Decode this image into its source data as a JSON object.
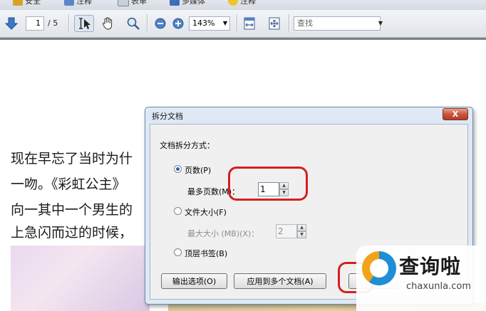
{
  "menu": {
    "items": [
      "安全",
      "注释",
      "表单",
      "多媒体",
      "注释"
    ]
  },
  "toolbar": {
    "page_current": "1",
    "page_total": "/ 5",
    "zoom": "143%",
    "search_placeholder": "查找"
  },
  "document": {
    "lines": [
      "现在早忘了当时为什",
      "一吻。《彩虹公主》",
      "向一其中一个男生的",
      "上急闪而过的时候，"
    ]
  },
  "dialog": {
    "title": "拆分文档",
    "close_label": "X",
    "section_label": "文档拆分方式：",
    "options": {
      "pages_label": "页数(P)",
      "max_pages_label": "最多页数(M)：",
      "max_pages_value": "1",
      "filesize_label": "文件大小(F)",
      "max_size_label": "最大大小 (MB)(X)：",
      "max_size_value": "2",
      "bookmark_label": "顶层书签(B)"
    },
    "buttons": {
      "output_options": "输出选项(O)",
      "apply_multiple": "应用到多个文档(A)"
    }
  },
  "watermark": {
    "title": "查询啦",
    "url": "chaxunla.com"
  },
  "colors": {
    "highlight": "#d51f1f",
    "dialog_frame": "#dfe9f5"
  }
}
